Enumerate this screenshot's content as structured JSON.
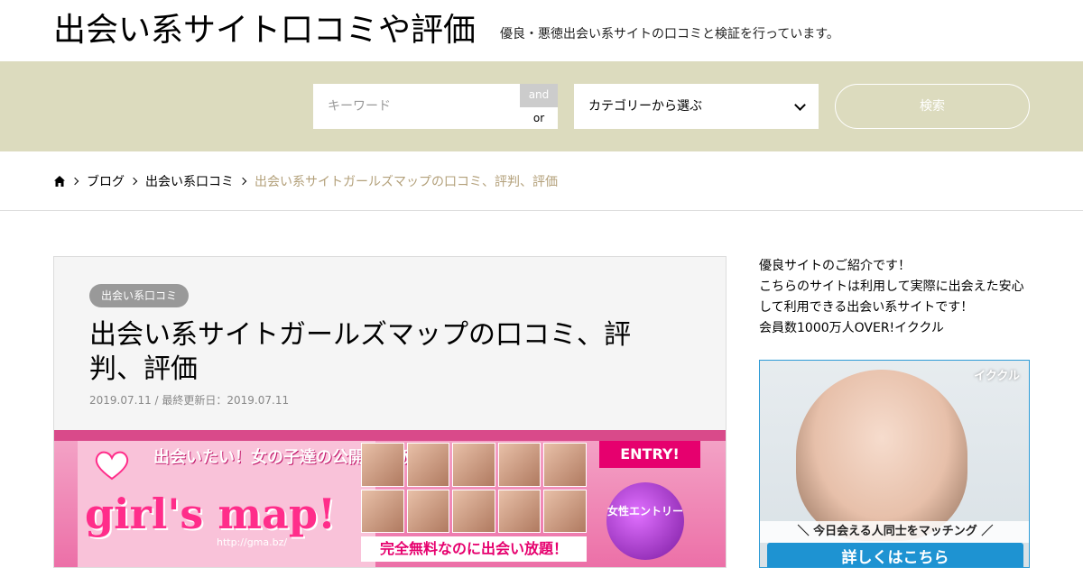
{
  "header": {
    "site_title": "出会い系サイト口コミや評価",
    "site_description": "優良・悪徳出会い系サイトの口コミと検証を行っています。"
  },
  "search": {
    "keyword_placeholder": "キーワード",
    "and_label": "and",
    "or_label": "or",
    "category_selected": "カテゴリーから選ぶ",
    "search_button": "検索"
  },
  "breadcrumb": {
    "home_icon": "home-icon",
    "items": [
      "ブログ",
      "出会い系口コミ"
    ],
    "current": "出会い系サイトガールズマップの口コミ、評判、評価"
  },
  "article": {
    "category": "出会い系口コミ",
    "title": "出会い系サイトガールズマップの口コミ、評判、評価",
    "date": "2019.07.11 / 最終更新日：2019.07.11",
    "hero": {
      "headline": "出会いたい！女の子達の公開掲示板",
      "logo": "girl's map!",
      "url": "http://gma.bz/",
      "free_text": "完全無料なのに出会い放題！",
      "entry": "ENTRY!",
      "ball_text": "女性エントリー"
    }
  },
  "sidebar": {
    "lines": [
      "優良サイトのご紹介です！",
      "こちらのサイトは利用して実際に出会えた安心して利用できる出会い系サイトです！",
      "会員数1000万人OVER!イククル"
    ],
    "ad": {
      "brand": "イククル",
      "band_text": "＼ 今日会える人同士をマッチング ／",
      "button": "詳しくはこちら"
    }
  },
  "colors": {
    "search_band": "#dcdbbe",
    "breadcrumb_current": "#b3a07a",
    "ad_button": "#1e93d2"
  }
}
